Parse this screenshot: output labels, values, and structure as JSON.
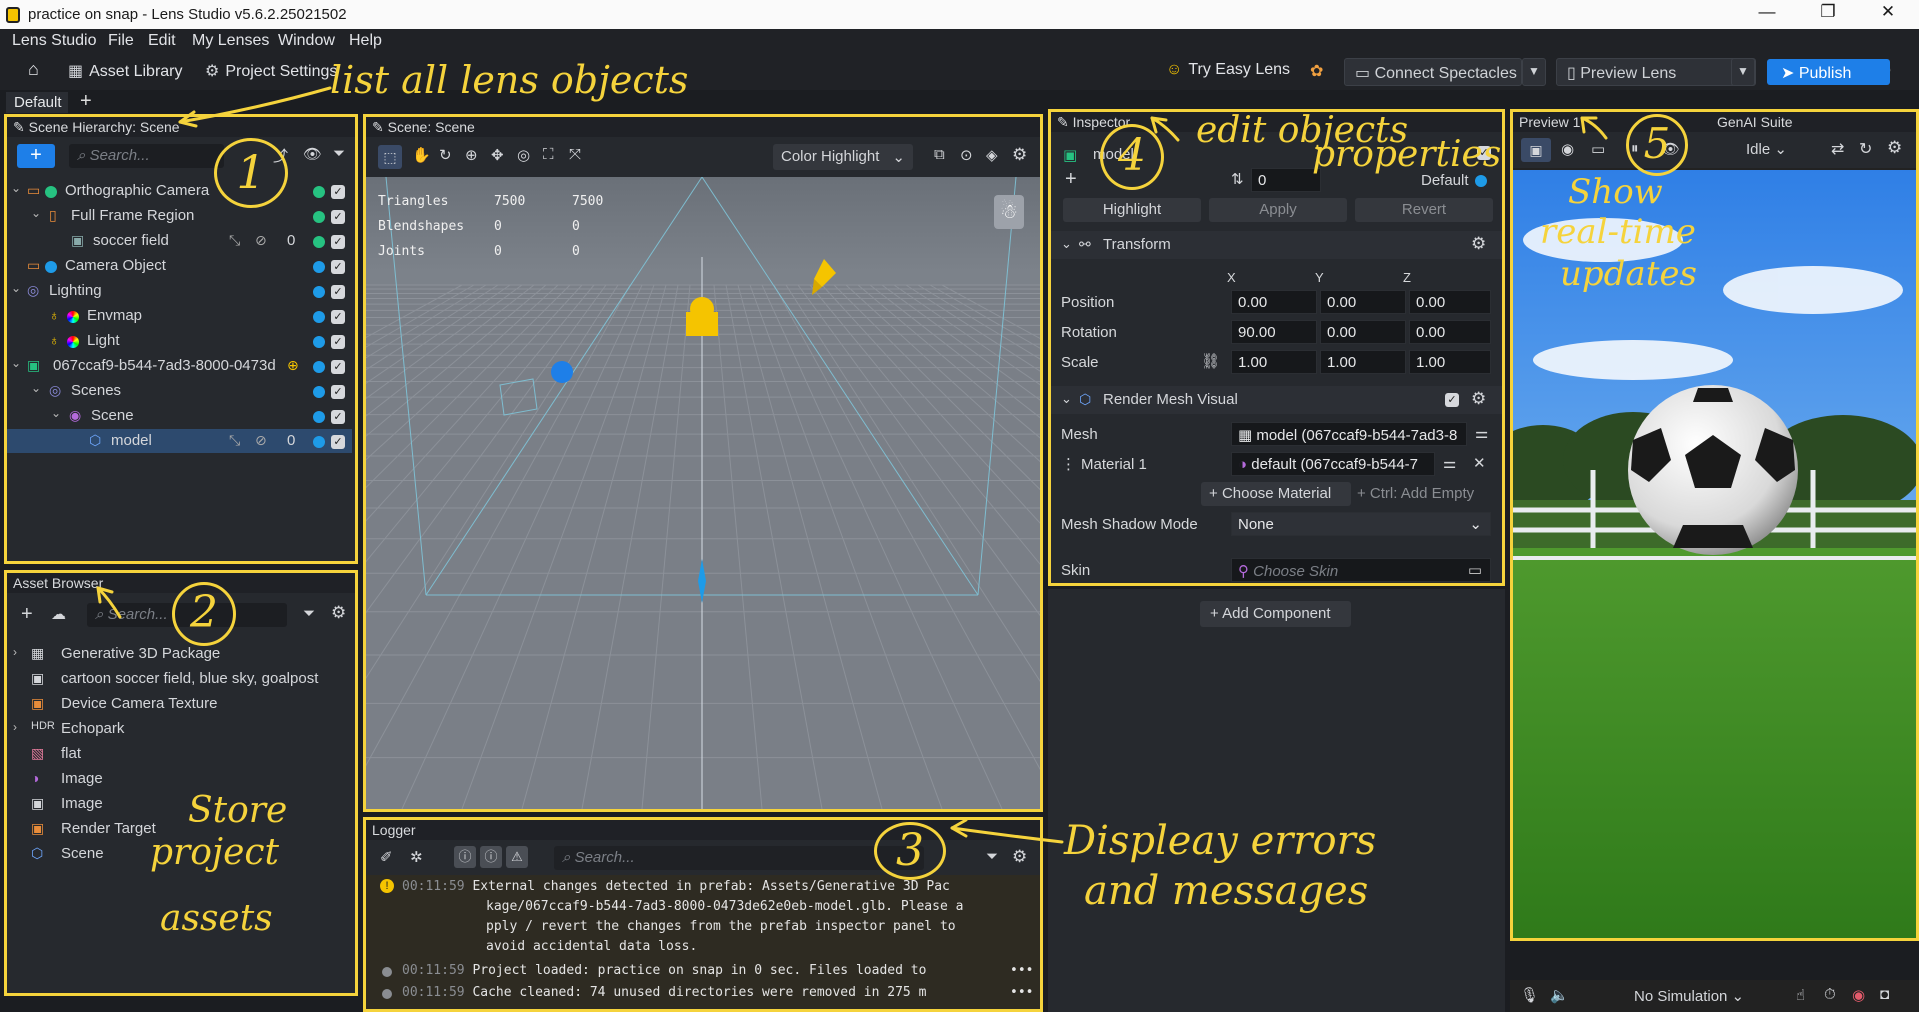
{
  "window": {
    "title": "practice on snap - Lens Studio v5.6.2.25021502"
  },
  "menu": [
    "Lens Studio",
    "File",
    "Edit",
    "My Lenses",
    "Window",
    "Help"
  ],
  "toolbar": {
    "asset_library": "Asset Library",
    "project_settings": "Project Settings",
    "try_easy_lens": "Try Easy Lens",
    "connect_spectacles": "Connect Spectacles",
    "preview_lens": "Preview Lens",
    "publish": "Publish"
  },
  "tabs": {
    "default": "Default",
    "add": "+"
  },
  "hierarchy": {
    "title": "Scene Hierarchy: Scene",
    "search_placeholder": "Search...",
    "items": [
      {
        "label": "Orthographic Camera"
      },
      {
        "label": "Full Frame Region"
      },
      {
        "label": "soccer field",
        "count": "0"
      },
      {
        "label": "Camera Object"
      },
      {
        "label": "Lighting"
      },
      {
        "label": "Envmap"
      },
      {
        "label": "Light"
      },
      {
        "label": "067ccaf9-b544-7ad3-8000-0473d"
      },
      {
        "label": "Scenes"
      },
      {
        "label": "Scene"
      },
      {
        "label": "model",
        "count": "0"
      }
    ]
  },
  "assets": {
    "title": "Asset Browser",
    "search_placeholder": "Search...",
    "items": [
      {
        "label": "Generative 3D Package"
      },
      {
        "label": "cartoon soccer field, blue sky, goalpost"
      },
      {
        "label": "Device Camera Texture"
      },
      {
        "label": "Echopark"
      },
      {
        "label": "flat"
      },
      {
        "label": "Image"
      },
      {
        "label": "Image"
      },
      {
        "label": "Render Target"
      },
      {
        "label": "Scene"
      }
    ]
  },
  "scene": {
    "title": "Scene: Scene",
    "highlight_mode": "Color Highlight",
    "stats": [
      {
        "name": "Triangles",
        "a": "7500",
        "b": "7500"
      },
      {
        "name": "Blendshapes",
        "a": "0",
        "b": "0"
      },
      {
        "name": "Joints",
        "a": "0",
        "b": "0"
      }
    ]
  },
  "logger": {
    "title": "Logger",
    "search_placeholder": "Search...",
    "rows": [
      {
        "time": "00:11:59",
        "text1": "External changes detected in prefab: Assets/Generative 3D Pac",
        "text2": "kage/067ccaf9-b544-7ad3-8000-0473de62e0eb-model.glb. Please a",
        "text3": "pply / revert the changes from the prefab inspector panel to",
        "text4": "avoid accidental data loss."
      },
      {
        "time": "00:11:59",
        "text1": "Project loaded: practice on snap in 0 sec. Files loaded to"
      },
      {
        "time": "00:11:59",
        "text1": "Cache cleaned: 74 unused directories were removed in 275 m"
      }
    ]
  },
  "inspector": {
    "title": "Inspector",
    "object_name": "model",
    "layer_value": "0",
    "layer_label": "Default",
    "buttons": {
      "highlight": "Highlight",
      "apply": "Apply",
      "revert": "Revert"
    },
    "transform": {
      "title": "Transform",
      "axes": [
        "X",
        "Y",
        "Z"
      ],
      "position_label": "Position",
      "position": [
        "0.00",
        "0.00",
        "0.00"
      ],
      "rotation_label": "Rotation",
      "rotation": [
        "90.00",
        "0.00",
        "0.00"
      ],
      "scale_label": "Scale",
      "scale": [
        "1.00",
        "1.00",
        "1.00"
      ]
    },
    "render_mesh": {
      "title": "Render Mesh Visual",
      "mesh_label": "Mesh",
      "mesh_value": "model (067ccaf9-b544-7ad3-8",
      "material_label": "Material 1",
      "material_value": "default (067ccaf9-b544-7",
      "choose_material": "Choose Material",
      "add_empty": "+ Ctrl: Add Empty",
      "shadow_label": "Mesh Shadow Mode",
      "shadow_value": "None",
      "skin_label": "Skin",
      "skin_placeholder": "Choose Skin"
    },
    "add_component": "Add Component"
  },
  "preview": {
    "title": "Preview 1",
    "genai": "GenAI Suite",
    "state": "Idle",
    "simulation": "No Simulation"
  },
  "annotations": {
    "hierarchy": "list all lens objects",
    "assets_line1": "Store",
    "assets_line2": "project",
    "assets_line3": "assets",
    "logger_line1": "Displeay errors",
    "logger_line2": "and messages",
    "inspector_line1": "edit objects",
    "inspector_line2": "properties",
    "preview_line1": "Show",
    "preview_line2": "real-time",
    "preview_line3": "updates",
    "n1": "1",
    "n2": "2",
    "n3": "3",
    "n4": "4",
    "n5": "5"
  },
  "colors": {
    "accent": "#f5d33c",
    "publish": "#1e7fe8",
    "selection": "#2d4a6e"
  }
}
